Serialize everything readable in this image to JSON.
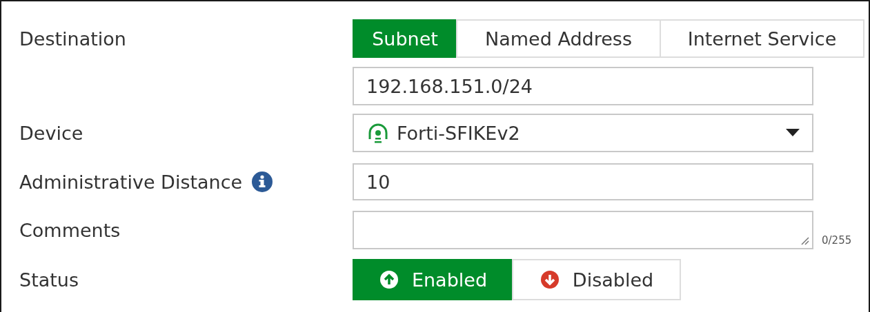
{
  "destination": {
    "label": "Destination",
    "options": [
      {
        "label": "Subnet",
        "selected": true
      },
      {
        "label": "Named Address",
        "selected": false
      },
      {
        "label": "Internet Service",
        "selected": false
      }
    ],
    "value": "192.168.151.0/24"
  },
  "device": {
    "label": "Device",
    "value": "Forti-SFIKEv2"
  },
  "distance": {
    "label": "Administrative Distance",
    "value": "10"
  },
  "comments": {
    "label": "Comments",
    "counter": "0/255"
  },
  "status": {
    "label": "Status",
    "options": [
      {
        "label": "Enabled",
        "selected": true,
        "kind": "up"
      },
      {
        "label": "Disabled",
        "selected": false,
        "kind": "down"
      }
    ]
  }
}
